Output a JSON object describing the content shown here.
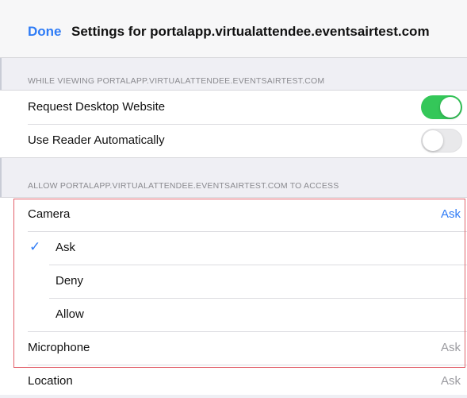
{
  "nav": {
    "done_label": "Done",
    "title": "Settings for portalapp.virtualattendee.eventsairtest.com"
  },
  "viewing": {
    "header": "WHILE VIEWING PORTALAPP.VIRTUALATTENDEE.EVENTSAIRTEST.COM",
    "request_desktop": {
      "label": "Request Desktop Website",
      "enabled": true
    },
    "reader": {
      "label": "Use Reader Automatically",
      "enabled": false
    }
  },
  "access": {
    "header": "ALLOW PORTALAPP.VIRTUALATTENDEE.EVENTSAIRTEST.COM TO ACCESS",
    "camera": {
      "label": "Camera",
      "value": "Ask"
    },
    "options": [
      {
        "label": "Ask",
        "selected": true
      },
      {
        "label": "Deny",
        "selected": false
      },
      {
        "label": "Allow",
        "selected": false
      }
    ],
    "checkmark": "✓",
    "microphone": {
      "label": "Microphone",
      "value": "Ask"
    },
    "location": {
      "label": "Location",
      "value": "Ask"
    }
  },
  "colors": {
    "accent": "#2f7cf6",
    "toggle_on": "#34c759",
    "highlight": "#e2606a"
  }
}
